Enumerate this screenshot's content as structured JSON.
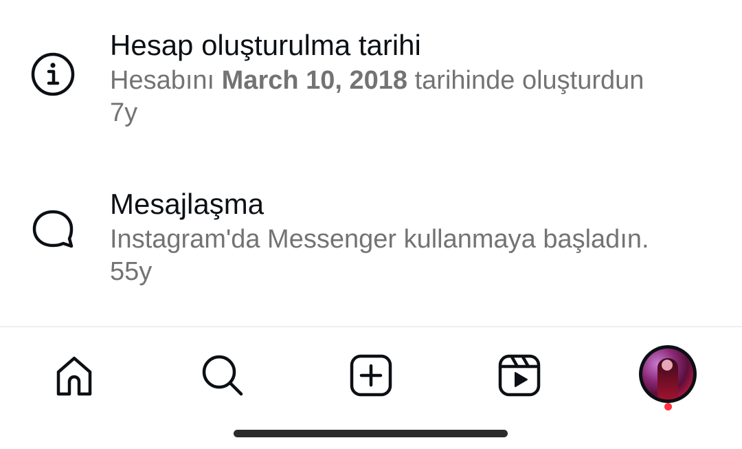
{
  "items": [
    {
      "icon": "info-icon",
      "title": "Hesap oluşturulma tarihi",
      "desc_prefix": "Hesabını ",
      "desc_date": "March 10, 2018",
      "desc_suffix": " tarihinde oluşturdun",
      "time": "7y"
    },
    {
      "icon": "message-bubble-icon",
      "title": "Mesajlaşma",
      "desc": "Instagram'da Messenger kullanmaya başladın.",
      "time": "55y"
    }
  ],
  "bottom_nav": {
    "items": [
      "home-icon",
      "search-icon",
      "create-post-icon",
      "reels-icon",
      "profile-avatar"
    ],
    "notification_color": "#ff3040"
  },
  "colors": {
    "title": "#0c1014",
    "secondary_text": "#737373",
    "icon": "#0c1014",
    "background": "#ffffff"
  }
}
